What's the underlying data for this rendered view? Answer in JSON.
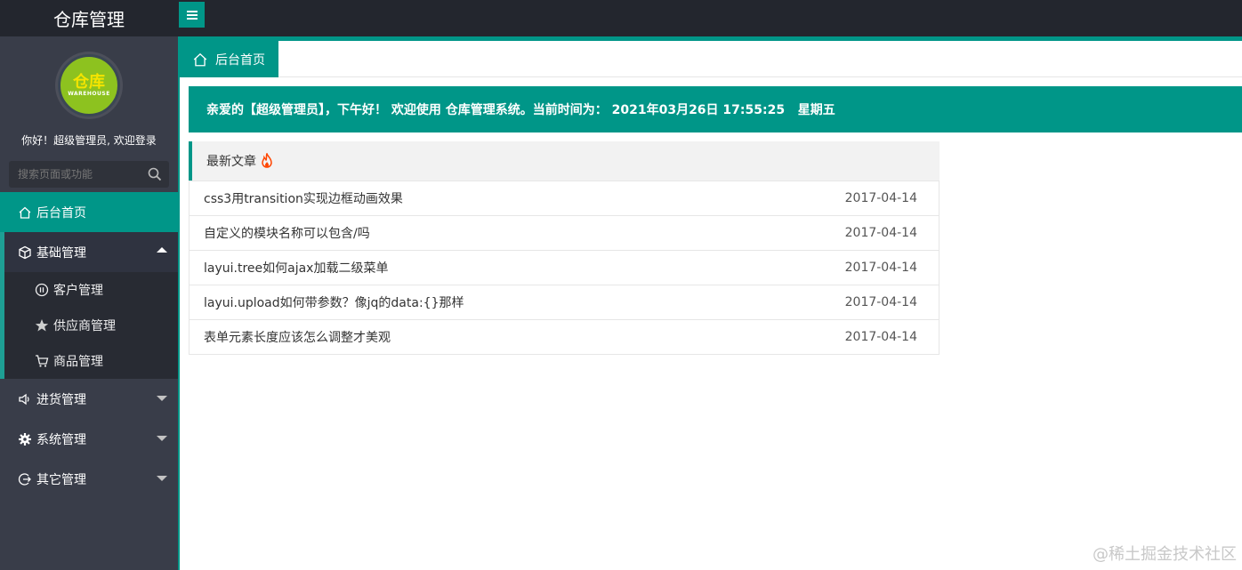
{
  "header": {
    "title": "仓库管理",
    "menu_toggle_icon": "hamburger-icon"
  },
  "sidebar": {
    "avatar_text": "仓库",
    "avatar_subtext": "WAREHOUSE",
    "welcome": "你好！超级管理员, 欢迎登录",
    "search_placeholder": "搜索页面或功能",
    "nav": {
      "home": {
        "label": "后台首页",
        "icon": "home-icon"
      },
      "basic": {
        "label": "基础管理",
        "icon": "cube-icon",
        "children": [
          {
            "label": "客户管理",
            "icon": "pause-circle-icon"
          },
          {
            "label": "供应商管理",
            "icon": "star-icon"
          },
          {
            "label": "商品管理",
            "icon": "cart-icon"
          }
        ]
      },
      "purchase": {
        "label": "进货管理",
        "icon": "speaker-icon"
      },
      "system": {
        "label": "系统管理",
        "icon": "gear-icon"
      },
      "other": {
        "label": "其它管理",
        "icon": "logout-icon"
      }
    }
  },
  "tabs": [
    {
      "label": "后台首页",
      "icon": "home-icon"
    }
  ],
  "banner": {
    "text": "亲爱的【超级管理员】，下午好！ 欢迎使用 仓库管理系统。当前时间为： 2021年03月26日 17:55:25   星期五"
  },
  "articles": {
    "title": "最新文章",
    "items": [
      {
        "title": "css3用transition实现边框动画效果",
        "date": "2017-04-14"
      },
      {
        "title": "自定义的模块名称可以包含/吗",
        "date": "2017-04-14"
      },
      {
        "title": "layui.tree如何ajax加载二级菜单",
        "date": "2017-04-14"
      },
      {
        "title": "layui.upload如何带参数？像jq的data:{}那样",
        "date": "2017-04-14"
      },
      {
        "title": "表单元素长度应该怎么调整才美观",
        "date": "2017-04-14"
      }
    ]
  },
  "watermark": "@稀土掘金技术社区",
  "colors": {
    "accent": "#009688",
    "sidebar": "#393d49",
    "header": "#23262e"
  }
}
